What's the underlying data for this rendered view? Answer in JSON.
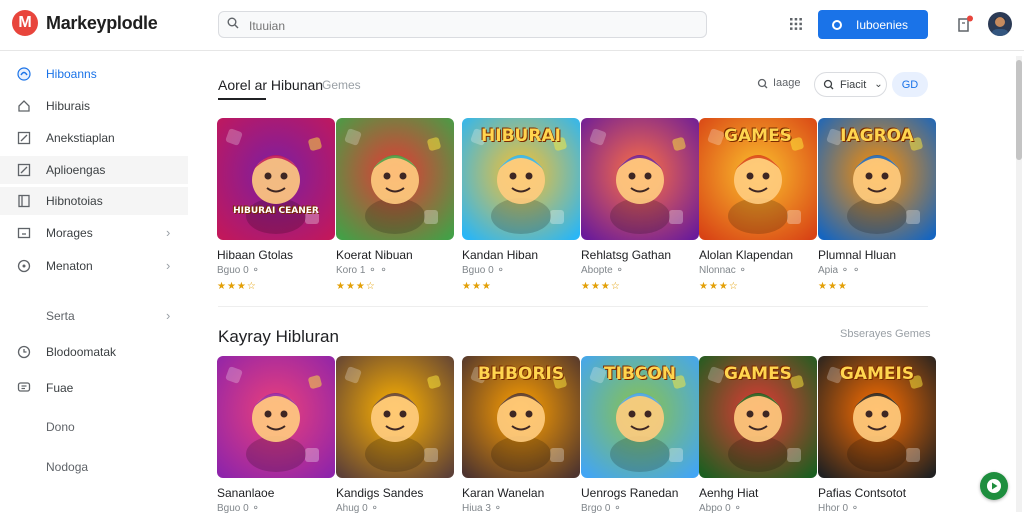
{
  "header": {
    "logo_letter": "M",
    "brand": "Markeyplodle",
    "search_placeholder": "Ituuian",
    "cta_label": "Iuboenies"
  },
  "sidebar": {
    "items": [
      {
        "label": "Hiboanns",
        "icon": "star-icon",
        "active": true
      },
      {
        "label": "Hiburais",
        "icon": "home-icon"
      },
      {
        "label": "Anekstiaplan",
        "icon": "edit-icon"
      },
      {
        "label": "Aplioengas",
        "icon": "pencil-icon",
        "highlight": true
      },
      {
        "label": "Hibnotoias",
        "icon": "book-icon",
        "highlight": true
      },
      {
        "label": "Morages",
        "icon": "box-icon",
        "chevron": true
      },
      {
        "label": "Menaton",
        "icon": "plus-circle-icon",
        "chevron": true
      },
      {
        "label": "Serta",
        "chevron": true
      },
      {
        "label": "Blodoomatak",
        "icon": "clock-icon"
      },
      {
        "label": "Fuae",
        "icon": "chat-icon"
      },
      {
        "label": "Dono"
      },
      {
        "label": "Nodoga"
      }
    ]
  },
  "section1": {
    "title": "Aorel ar Hibunan",
    "tab_secondary": "Gemes",
    "filter_label": "Iaage",
    "dropdown_label": "Fiacit",
    "toggle_label": "GD"
  },
  "section2": {
    "title": "Kayray Hibluran",
    "link": "Sbserayes Gemes"
  },
  "row1": [
    {
      "title": "Hibaan Gtolas",
      "sub": "Bguo 0 ⚬",
      "stars": "★★★☆",
      "palette": [
        "#c2185b",
        "#7b1fa2"
      ],
      "banner": "HIBURAI CEANER"
    },
    {
      "title": "Koerat Nibuan",
      "sub": "Koro 1 ⚬ ⚬",
      "stars": "★★★☆",
      "palette": [
        "#43a047",
        "#e53935"
      ],
      "banner": ""
    },
    {
      "title": "Kandan Hiban",
      "sub": "Bguo 0 ⚬",
      "stars": "★★★",
      "palette": [
        "#29b6f6",
        "#fbc02d"
      ],
      "banner": "HIBURAI"
    },
    {
      "title": "Rehlatsg Gathan",
      "sub": "Abopte ⚬",
      "stars": "★★★☆",
      "palette": [
        "#6a1b9a",
        "#ff7043"
      ],
      "banner": ""
    },
    {
      "title": "Alolan Klapendan",
      "sub": "Nlonnac ⚬",
      "stars": "★★★☆",
      "palette": [
        "#d84315",
        "#fbc02d"
      ],
      "banner": "GAMES"
    },
    {
      "title": "Plumnal Hluan",
      "sub": "Apia ⚬ ⚬",
      "stars": "★★★",
      "palette": [
        "#1565c0",
        "#ff8f00"
      ],
      "banner": "IAGROA"
    }
  ],
  "row2": [
    {
      "title": "Sananlaoe",
      "sub": "Bguo 0 ⚬",
      "palette": [
        "#8e24aa",
        "#ec407a"
      ],
      "banner": ""
    },
    {
      "title": "Kandigs Sandes",
      "sub": "Ahug 0 ⚬",
      "palette": [
        "#5d4037",
        "#ffb300"
      ],
      "banner": ""
    },
    {
      "title": "Karan Wanelan",
      "sub": "Hiua 3 ⚬",
      "palette": [
        "#4e342e",
        "#ffa000"
      ],
      "banner": "BHBORIS"
    },
    {
      "title": "Uenrogs Ranedan",
      "sub": "Brgo 0 ⚬",
      "palette": [
        "#42a5f5",
        "#8bc34a"
      ],
      "banner": "TIBCON"
    },
    {
      "title": "Aenhg Hiat",
      "sub": "Abpo 0 ⚬",
      "palette": [
        "#1b5e20",
        "#e53935"
      ],
      "banner": "GAMES"
    },
    {
      "title": "Pafias Contsotot",
      "sub": "Hhor 0 ⚬",
      "palette": [
        "#212121",
        "#ff6f00"
      ],
      "banner": "GAMEIS"
    }
  ]
}
